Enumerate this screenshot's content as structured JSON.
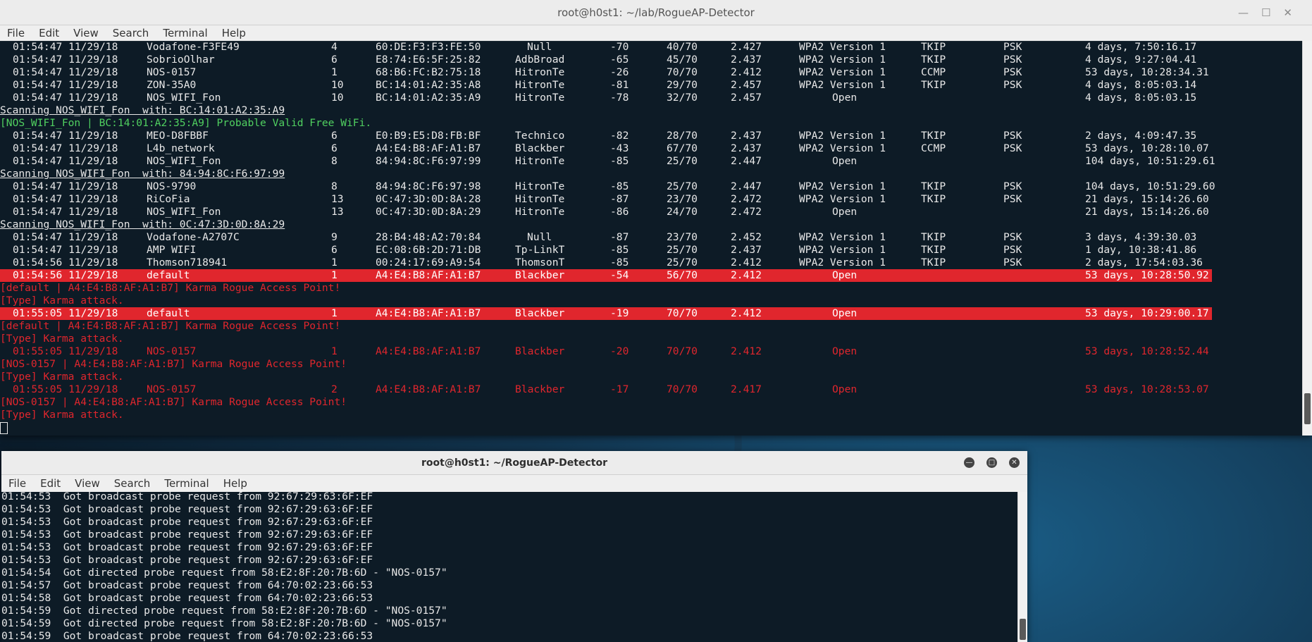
{
  "window1": {
    "title": "root@h0st1: ~/lab/RogueAP-Detector",
    "menu": [
      "File",
      "Edit",
      "View",
      "Search",
      "Terminal",
      "Help"
    ],
    "rows": [
      {
        "kind": "row",
        "style": "normal",
        "time": "01:54:47 11/29/18",
        "ssid": "Vodafone-F3FE49",
        "ch": "4",
        "mac": "60:DE:F3:F3:FE:50",
        "vendor": "Null",
        "sig": "-70",
        "qual": "40/70",
        "freq": "2.427",
        "enc": "WPA2 Version 1",
        "cipher": "TKIP",
        "auth": "PSK",
        "uptime": "4 days, 7:50:16.17"
      },
      {
        "kind": "row",
        "style": "normal",
        "time": "01:54:47 11/29/18",
        "ssid": "SobrioOlhar",
        "ch": "6",
        "mac": "E8:74:E6:5F:25:82",
        "vendor": "AdbBroad",
        "sig": "-65",
        "qual": "45/70",
        "freq": "2.437",
        "enc": "WPA2 Version 1",
        "cipher": "TKIP",
        "auth": "PSK",
        "uptime": "4 days, 9:27:04.41"
      },
      {
        "kind": "row",
        "style": "normal",
        "time": "01:54:47 11/29/18",
        "ssid": "NOS-0157",
        "ch": "1",
        "mac": "68:B6:FC:B2:75:18",
        "vendor": "HitronTe",
        "sig": "-26",
        "qual": "70/70",
        "freq": "2.412",
        "enc": "WPA2 Version 1",
        "cipher": "CCMP",
        "auth": "PSK",
        "uptime": "53 days, 10:28:34.31"
      },
      {
        "kind": "row",
        "style": "normal",
        "time": "01:54:47 11/29/18",
        "ssid": "ZON-35A0",
        "ch": "10",
        "mac": "BC:14:01:A2:35:A8",
        "vendor": "HitronTe",
        "sig": "-81",
        "qual": "29/70",
        "freq": "2.457",
        "enc": "WPA2 Version 1",
        "cipher": "TKIP",
        "auth": "PSK",
        "uptime": "4 days, 8:05:03.14"
      },
      {
        "kind": "row",
        "style": "normal",
        "time": "01:54:47 11/29/18",
        "ssid": "NOS_WIFI_Fon",
        "ch": "10",
        "mac": "BC:14:01:A2:35:A9",
        "vendor": "HitronTe",
        "sig": "-78",
        "qual": "32/70",
        "freq": "2.457",
        "enc": "Open",
        "cipher": "",
        "auth": "",
        "uptime": "4 days, 8:05:03.15"
      },
      {
        "kind": "text",
        "style": "ul",
        "text": "Scanning NOS_WIFI_Fon  with: BC:14:01:A2:35:A9"
      },
      {
        "kind": "text",
        "style": "green",
        "text": "[NOS_WIFI_Fon | BC:14:01:A2:35:A9] Probable Valid Free WiFi."
      },
      {
        "kind": "row",
        "style": "normal",
        "time": "01:54:47 11/29/18",
        "ssid": "MEO-D8FBBF",
        "ch": "6",
        "mac": "E0:B9:E5:D8:FB:BF",
        "vendor": "Technico",
        "sig": "-82",
        "qual": "28/70",
        "freq": "2.437",
        "enc": "WPA2 Version 1",
        "cipher": "TKIP",
        "auth": "PSK",
        "uptime": "2 days, 4:09:47.35"
      },
      {
        "kind": "row",
        "style": "normal",
        "time": "01:54:47 11/29/18",
        "ssid": "L4b_network",
        "ch": "6",
        "mac": "A4:E4:B8:AF:A1:B7",
        "vendor": "Blackber",
        "sig": "-43",
        "qual": "67/70",
        "freq": "2.437",
        "enc": "WPA2 Version 1",
        "cipher": "CCMP",
        "auth": "PSK",
        "uptime": "53 days, 10:28:10.07"
      },
      {
        "kind": "row",
        "style": "normal",
        "time": "01:54:47 11/29/18",
        "ssid": "NOS_WIFI_Fon",
        "ch": "8",
        "mac": "84:94:8C:F6:97:99",
        "vendor": "HitronTe",
        "sig": "-85",
        "qual": "25/70",
        "freq": "2.447",
        "enc": "Open",
        "cipher": "",
        "auth": "",
        "uptime": "104 days, 10:51:29.61"
      },
      {
        "kind": "text",
        "style": "ul",
        "text": "Scanning NOS_WIFI_Fon  with: 84:94:8C:F6:97:99"
      },
      {
        "kind": "row",
        "style": "normal",
        "time": "01:54:47 11/29/18",
        "ssid": "NOS-9790",
        "ch": "8",
        "mac": "84:94:8C:F6:97:98",
        "vendor": "HitronTe",
        "sig": "-85",
        "qual": "25/70",
        "freq": "2.447",
        "enc": "WPA2 Version 1",
        "cipher": "TKIP",
        "auth": "PSK",
        "uptime": "104 days, 10:51:29.60"
      },
      {
        "kind": "row",
        "style": "normal",
        "time": "01:54:47 11/29/18",
        "ssid": "RiCoFia",
        "ch": "13",
        "mac": "0C:47:3D:0D:8A:28",
        "vendor": "HitronTe",
        "sig": "-87",
        "qual": "23/70",
        "freq": "2.472",
        "enc": "WPA2 Version 1",
        "cipher": "TKIP",
        "auth": "PSK",
        "uptime": "21 days, 15:14:26.60"
      },
      {
        "kind": "row",
        "style": "normal",
        "time": "01:54:47 11/29/18",
        "ssid": "NOS_WIFI_Fon",
        "ch": "13",
        "mac": "0C:47:3D:0D:8A:29",
        "vendor": "HitronTe",
        "sig": "-86",
        "qual": "24/70",
        "freq": "2.472",
        "enc": "Open",
        "cipher": "",
        "auth": "",
        "uptime": "21 days, 15:14:26.60"
      },
      {
        "kind": "text",
        "style": "ul",
        "text": "Scanning NOS_WIFI_Fon  with: 0C:47:3D:0D:8A:29"
      },
      {
        "kind": "row",
        "style": "normal",
        "time": "01:54:47 11/29/18",
        "ssid": "Vodafone-A2707C",
        "ch": "9",
        "mac": "28:B4:48:A2:70:84",
        "vendor": "Null",
        "sig": "-87",
        "qual": "23/70",
        "freq": "2.452",
        "enc": "WPA2 Version 1",
        "cipher": "TKIP",
        "auth": "PSK",
        "uptime": "3 days, 4:39:30.03"
      },
      {
        "kind": "row",
        "style": "normal",
        "time": "01:54:47 11/29/18",
        "ssid": "AMP WIFI",
        "ch": "6",
        "mac": "EC:08:6B:2D:71:DB",
        "vendor": "Tp-LinkT",
        "sig": "-85",
        "qual": "25/70",
        "freq": "2.437",
        "enc": "WPA2 Version 1",
        "cipher": "TKIP",
        "auth": "PSK",
        "uptime": "1 day, 10:38:41.86"
      },
      {
        "kind": "row",
        "style": "normal",
        "time": "01:54:56 11/29/18",
        "ssid": "Thomson718941",
        "ch": "1",
        "mac": "00:24:17:69:A9:54",
        "vendor": "ThomsonT",
        "sig": "-85",
        "qual": "25/70",
        "freq": "2.412",
        "enc": "WPA2 Version 1",
        "cipher": "TKIP",
        "auth": "PSK",
        "uptime": "2 days, 17:54:03.36"
      },
      {
        "kind": "row",
        "style": "hl",
        "time": "01:54:56 11/29/18",
        "ssid": "default",
        "ch": "1",
        "mac": "A4:E4:B8:AF:A1:B7",
        "vendor": "Blackber",
        "sig": "-54",
        "qual": "56/70",
        "freq": "2.412",
        "enc": "Open",
        "cipher": "",
        "auth": "",
        "uptime": "53 days, 10:28:50.92"
      },
      {
        "kind": "text",
        "style": "red",
        "text": "[default | A4:E4:B8:AF:A1:B7] Karma Rogue Access Point!"
      },
      {
        "kind": "text",
        "style": "red",
        "text": "[Type] Karma attack."
      },
      {
        "kind": "row",
        "style": "hl",
        "time": "01:55:05 11/29/18",
        "ssid": "default",
        "ch": "1",
        "mac": "A4:E4:B8:AF:A1:B7",
        "vendor": "Blackber",
        "sig": "-19",
        "qual": "70/70",
        "freq": "2.412",
        "enc": "Open",
        "cipher": "",
        "auth": "",
        "uptime": "53 days, 10:29:00.17"
      },
      {
        "kind": "text",
        "style": "red",
        "text": "[default | A4:E4:B8:AF:A1:B7] Karma Rogue Access Point!"
      },
      {
        "kind": "text",
        "style": "red",
        "text": "[Type] Karma attack."
      },
      {
        "kind": "row",
        "style": "red",
        "time": "01:55:05 11/29/18",
        "ssid": "NOS-0157",
        "ch": "1",
        "mac": "A4:E4:B8:AF:A1:B7",
        "vendor": "Blackber",
        "sig": "-20",
        "qual": "70/70",
        "freq": "2.412",
        "enc": "Open",
        "cipher": "",
        "auth": "",
        "uptime": "53 days, 10:28:52.44"
      },
      {
        "kind": "text",
        "style": "red",
        "text": "[NOS-0157 | A4:E4:B8:AF:A1:B7] Karma Rogue Access Point!"
      },
      {
        "kind": "text",
        "style": "red",
        "text": "[Type] Karma attack."
      },
      {
        "kind": "row",
        "style": "red",
        "time": "01:55:05 11/29/18",
        "ssid": "NOS-0157",
        "ch": "2",
        "mac": "A4:E4:B8:AF:A1:B7",
        "vendor": "Blackber",
        "sig": "-17",
        "qual": "70/70",
        "freq": "2.417",
        "enc": "Open",
        "cipher": "",
        "auth": "",
        "uptime": "53 days, 10:28:53.07"
      },
      {
        "kind": "text",
        "style": "red",
        "text": "[NOS-0157 | A4:E4:B8:AF:A1:B7] Karma Rogue Access Point!"
      },
      {
        "kind": "text",
        "style": "red",
        "text": "[Type] Karma attack."
      },
      {
        "kind": "cursor"
      }
    ]
  },
  "window2": {
    "title": "root@h0st1: ~/RogueAP-Detector",
    "menu": [
      "File",
      "Edit",
      "View",
      "Search",
      "Terminal",
      "Help"
    ],
    "lines": [
      "01:54:53  Got broadcast probe request from 92:67:29:63:6F:EF",
      "01:54:53  Got broadcast probe request from 92:67:29:63:6F:EF",
      "01:54:53  Got broadcast probe request from 92:67:29:63:6F:EF",
      "01:54:53  Got broadcast probe request from 92:67:29:63:6F:EF",
      "01:54:53  Got broadcast probe request from 92:67:29:63:6F:EF",
      "01:54:53  Got broadcast probe request from 92:67:29:63:6F:EF",
      "01:54:54  Got directed probe request from 58:E2:8F:20:7B:6D - \"NOS-0157\"",
      "01:54:57  Got broadcast probe request from 64:70:02:23:66:53",
      "01:54:58  Got broadcast probe request from 64:70:02:23:66:53",
      "01:54:59  Got directed probe request from 58:E2:8F:20:7B:6D - \"NOS-0157\"",
      "01:54:59  Got directed probe request from 58:E2:8F:20:7B:6D - \"NOS-0157\"",
      "01:54:59  Got broadcast probe request from 64:70:02:23:66:53"
    ]
  },
  "colors": {
    "alert": "#e0262d",
    "ok": "#50d060",
    "text": "#e8e8e8",
    "bg": "#0d1b26"
  }
}
